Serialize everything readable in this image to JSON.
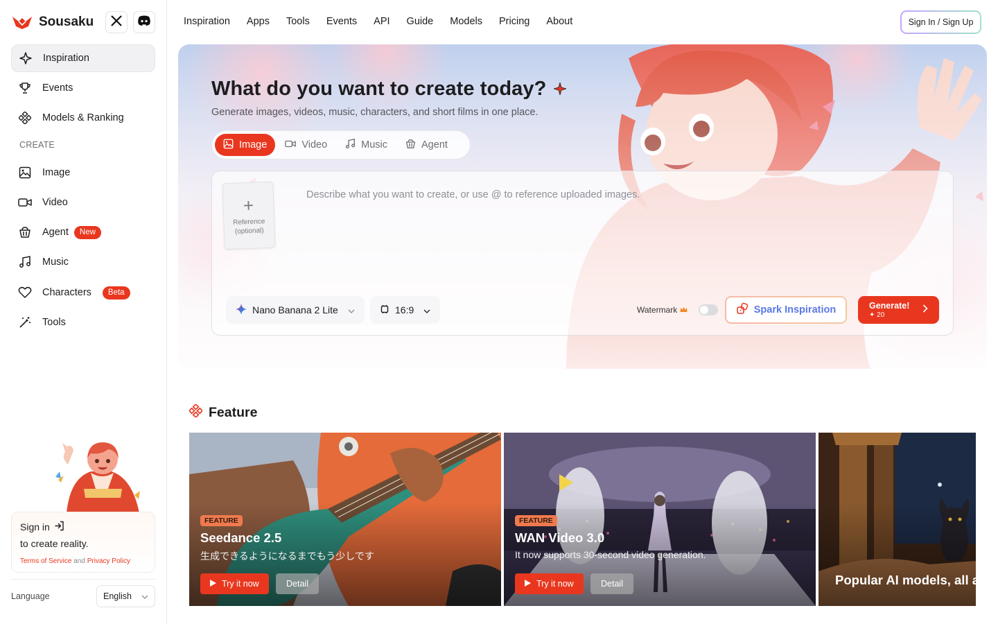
{
  "brand": {
    "name": "Sousaku",
    "logo": "fox-logo-icon"
  },
  "social": [
    {
      "name": "x-icon"
    },
    {
      "name": "discord-icon"
    }
  ],
  "sidebar": {
    "items": [
      {
        "label": "Inspiration",
        "icon": "sparkle-icon",
        "active": true
      },
      {
        "label": "Events",
        "icon": "trophy-icon"
      },
      {
        "label": "Models & Ranking",
        "icon": "models-icon"
      }
    ],
    "create_label": "CREATE",
    "create_items": [
      {
        "label": "Image",
        "icon": "image-icon"
      },
      {
        "label": "Video",
        "icon": "video-icon"
      },
      {
        "label": "Agent",
        "icon": "agent-icon",
        "badge": "New"
      },
      {
        "label": "Music",
        "icon": "music-icon"
      },
      {
        "label": "Characters",
        "icon": "heart-icon",
        "badge": "Beta"
      },
      {
        "label": "Tools",
        "icon": "wand-icon"
      }
    ],
    "signin": {
      "title": "Sign in",
      "subtitle": "to create reality.",
      "terms": "Terms of Service",
      "and": "and",
      "privacy": "Privacy Policy"
    },
    "language_label": "Language",
    "language_value": "English"
  },
  "topnav": {
    "links": [
      "Inspiration",
      "Apps",
      "Tools",
      "Events",
      "API",
      "Guide",
      "Models",
      "Pricing",
      "About"
    ],
    "auth": "Sign In / Sign Up"
  },
  "hero": {
    "title": "What do you want to create today?",
    "subtitle": "Generate images, videos, music, characters, and short films in one place.",
    "tabs": [
      {
        "label": "Image",
        "icon": "image-icon",
        "active": true
      },
      {
        "label": "Video",
        "icon": "video-icon"
      },
      {
        "label": "Music",
        "icon": "music-icon"
      },
      {
        "label": "Agent",
        "icon": "agent-icon"
      }
    ],
    "reference_title": "Reference",
    "reference_sub": "(optional)",
    "prompt_placeholder": "Describe what you want to create, or use @ to reference uploaded images.",
    "prompt_value": "",
    "model": "Nano Banana 2 Lite",
    "ratio": "16:9",
    "watermark_label": "Watermark",
    "watermark_on": false,
    "spark_label": "Spark Inspiration",
    "generate_label": "Generate!",
    "generate_cost": "20"
  },
  "feature": {
    "title": "Feature",
    "cards": [
      {
        "tag": "FEATURE",
        "title": "Seedance 2.5",
        "desc": "生成できるようになるまでもう少しです",
        "try": "Try it now",
        "detail": "Detail"
      },
      {
        "tag": "FEATURE",
        "title": "WAN Video 3.0",
        "desc": "It now supports 30-second video generation.",
        "try": "Try it now",
        "detail": "Detail"
      },
      {
        "title": "Popular AI models, all a"
      }
    ]
  },
  "colors": {
    "accent": "#e9371f",
    "spark": "#5a79e6"
  }
}
